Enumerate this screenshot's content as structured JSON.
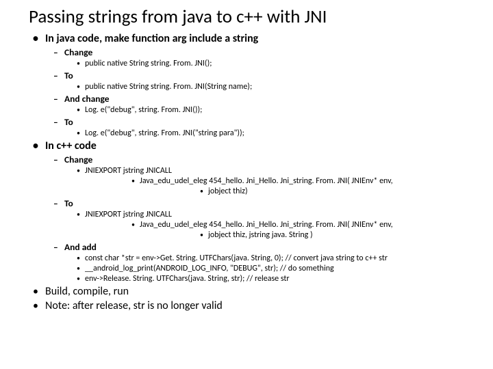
{
  "title": "Passing strings from java to c++ with JNI",
  "b1": "In java code, make  function arg include a string",
  "b1a": "Change",
  "b1a1": "public native String  string. From. JNI();",
  "b1b": "To",
  "b1b1": "public native String  string. From. JNI(String name);",
  "b1c": "And change",
  "b1c1": "Log. e(\"debug\", string. From. JNI());",
  "b1d": "To",
  "b1d1": "Log. e(\"debug\", string. From. JNI(\"string para\"));",
  "b2": "In c++ code",
  "b2a": "Change",
  "b2a1": "JNIEXPORT jstring JNICALL",
  "b2a2": "Java_edu_udel_eleg 454_hello. Jni_Hello. Jni_string. From. JNI( JNIEnv* env,",
  "b2a3": "jobject thiz)",
  "b2b": "To",
  "b2b1": "JNIEXPORT jstring JNICALL",
  "b2b2": "Java_edu_udel_eleg 454_hello. Jni_Hello. Jni_string. From. JNI( JNIEnv* env,",
  "b2b3": "jobject thiz, jstring java. String )",
  "b2c": "And add",
  "b2c1": "const char *str = env->Get. String. UTFChars(java. String, 0); // convert java string to c++ str",
  "b2c2": "__android_log_print(ANDROID_LOG_INFO, \"DEBUG\", str); // do something",
  "b2c3": "env->Release. String. UTFChars(java. String, str); // release str",
  "b3": "Build, compile, run",
  "b4": "Note:  after release, str is no longer valid"
}
